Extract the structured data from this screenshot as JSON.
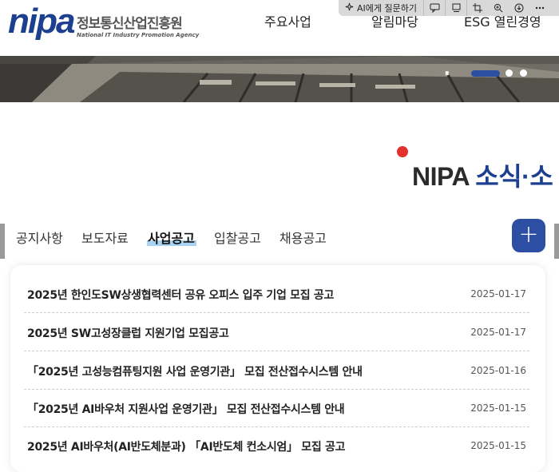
{
  "header": {
    "logo_mark": "nipa",
    "logo_korean": "정보통신산업진흥원",
    "logo_english": "National IT Industry Promotion Agency",
    "nav": [
      "주요사업",
      "알림마당",
      "ESG 열린경영"
    ]
  },
  "browser_overlay": {
    "ai_label": "AI에게 질문하기",
    "icons": [
      "sparkle-icon",
      "comment-icon",
      "reader-icon",
      "crop-icon",
      "zoom-in-icon",
      "download-icon",
      "more-icon"
    ]
  },
  "hero": {
    "pause_glyph": "⏸",
    "slides_total": 3,
    "active_slide": 1
  },
  "section": {
    "title_part1": "NIPA ",
    "title_part2": "소식·소"
  },
  "tabs": {
    "items": [
      "공지사항",
      "보도자료",
      "사업공고",
      "입찰공고",
      "채용공고"
    ],
    "active": "사업공고",
    "more_label": "+"
  },
  "notices": [
    {
      "title": "2025년 한인도SW상생협력센터 공유 오피스 입주 기업 모집 공고",
      "date": "2025-01-17"
    },
    {
      "title": "2025년 SW고성장클럽 지원기업 모집공고",
      "date": "2025-01-17"
    },
    {
      "title": "「2025년 고성능컴퓨팅지원 사업 운영기관」 모집 전산접수시스템 안내",
      "date": "2025-01-16"
    },
    {
      "title": "「2025년 AI바우처 지원사업 운영기관」 모집 전산접수시스템 안내",
      "date": "2025-01-15"
    },
    {
      "title": "2025년 AI바우처(AI반도체분과) 「AI반도체 컨소시엄」 모집 공고",
      "date": "2025-01-15"
    }
  ],
  "colors": {
    "brand_blue": "#1d3f8f",
    "accent_red": "#e3312d",
    "button_blue": "#2c4fa3",
    "tab_highlight": "#a9d3f3"
  }
}
